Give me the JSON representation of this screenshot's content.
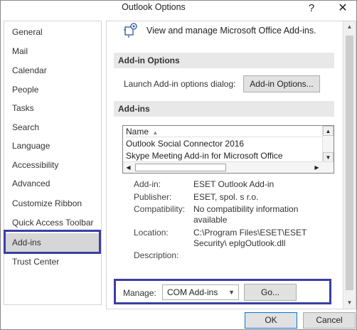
{
  "window": {
    "title": "Outlook Options",
    "help_glyph": "?",
    "close_glyph": "✕"
  },
  "sidebar": {
    "items": [
      {
        "label": "General"
      },
      {
        "label": "Mail"
      },
      {
        "label": "Calendar"
      },
      {
        "label": "People"
      },
      {
        "label": "Tasks"
      },
      {
        "label": "Search"
      },
      {
        "label": "Language"
      },
      {
        "label": "Accessibility"
      },
      {
        "label": "Advanced"
      },
      {
        "label": "Customize Ribbon"
      },
      {
        "label": "Quick Access Toolbar"
      },
      {
        "label": "Add-ins",
        "selected": true
      },
      {
        "label": "Trust Center"
      }
    ]
  },
  "main": {
    "header": "View and manage Microsoft Office Add-ins.",
    "addin_options": {
      "section_title": "Add-in Options",
      "launch_label": "Launch Add-in options dialog:",
      "button_label": "Add-in Options..."
    },
    "addins": {
      "section_title": "Add-ins",
      "column_header": "Name",
      "rows": [
        "Outlook Social Connector 2016",
        "Skype Meeting Add-in for Microsoft Office"
      ]
    },
    "details": {
      "addin_label": "Add-in:",
      "addin_value": "ESET Outlook Add-in",
      "publisher_label": "Publisher:",
      "publisher_value": "ESET, spol. s r.o.",
      "compat_label": "Compatibility:",
      "compat_value": "No compatibility information available",
      "location_label": "Location:",
      "location_value": "C:\\Program Files\\ESET\\ESET Security\\ eplgOutlook.dll",
      "description_label": "Description:"
    },
    "manage": {
      "label": "Manage:",
      "selected_option": "COM Add-ins",
      "go_label": "Go..."
    }
  },
  "footer": {
    "ok_label": "OK",
    "cancel_label": "Cancel"
  },
  "colors": {
    "highlight_border": "#3a3fa6",
    "selected_bg": "#d6d6d6",
    "section_bg": "#e8e8e8"
  }
}
